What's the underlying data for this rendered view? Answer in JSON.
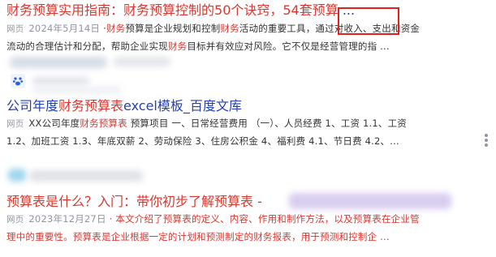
{
  "results": [
    {
      "title_parts": [
        {
          "text": "财务预算实用指南：",
          "hl": true
        },
        {
          "text": "财务预算控制的50个诀窍，54套预算",
          "hl": true
        },
        {
          "text": " ...",
          "hl": false
        }
      ],
      "tag": "网页",
      "date": "2024年5月14日",
      "line1_parts": [
        {
          "text": "·",
          "hl": false
        },
        {
          "text": "财务",
          "hl": true
        },
        {
          "text": "预算是企业规划和控制",
          "hl": false
        },
        {
          "text": "财务",
          "hl": true
        },
        {
          "text": "活动的重要工具，通过对收入、支出和资金",
          "hl": false
        }
      ],
      "line2_parts": [
        {
          "text": "流动的合理估计和分配，帮助企业实现",
          "hl": false
        },
        {
          "text": "财务",
          "hl": true
        },
        {
          "text": "目标并有效应对风险。它不仅是经营管理的指 ...",
          "hl": false
        }
      ]
    },
    {
      "title_parts": [
        {
          "text": "公司年度",
          "hl": false
        },
        {
          "text": "财务预算表",
          "hl": true
        },
        {
          "text": "excel模板_百度文库",
          "hl": false
        }
      ],
      "tag": "网页",
      "line1_parts": [
        {
          "text": "XX公司年度",
          "hl": false
        },
        {
          "text": "财务预算表",
          "hl": true
        },
        {
          "text": " 预算项目 一、日常经营费用 （一）、人员经费 1、工资 1.1、工资",
          "hl": false
        }
      ],
      "line2_parts": [
        {
          "text": "1.2、加班工资 1.3、年底双薪 2、劳动保险 3、住房公积金 4、福利费 4.1、节日费 4.2、...",
          "hl": false
        }
      ]
    },
    {
      "title_parts": [
        {
          "text": "预算表是什么？入门：带你初步了解预算表 -",
          "hl": true
        }
      ],
      "tag": "网页",
      "date": "2023年12月27日",
      "line1_parts": [
        {
          "text": "· 本文介绍了",
          "hl": false
        },
        {
          "text": "预算表",
          "hl": true
        },
        {
          "text": "的定义、内容、作用和制作方法，以及",
          "hl": false
        },
        {
          "text": "预算表",
          "hl": true
        },
        {
          "text": "在企业管",
          "hl": false
        }
      ],
      "line2_parts": [
        {
          "text": "理中的重要性。",
          "hl": false
        },
        {
          "text": "预算表",
          "hl": true
        },
        {
          "text": "是企业根据一定的计划和预测制定的财务报表，用于预测和控制企 ...",
          "hl": false
        }
      ]
    }
  ],
  "colors": {
    "title_blue": "#2440b3",
    "highlight_red": "#d8372f",
    "meta_gray": "#9195a3",
    "annotation_red": "#e02020"
  },
  "icons": [
    "baidu-paw-icon",
    "more-dots-icon"
  ]
}
